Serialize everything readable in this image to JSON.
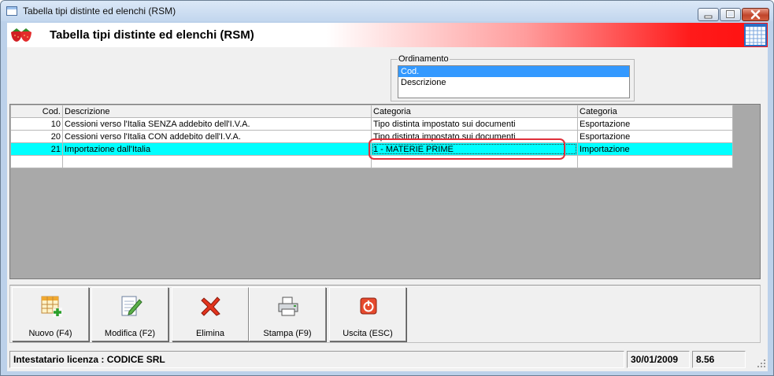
{
  "window": {
    "title": "Tabella tipi distinte ed elenchi (RSM)"
  },
  "header": {
    "title": "Tabella tipi distinte ed elenchi (RSM)"
  },
  "sort": {
    "legend": "Ordinamento",
    "options": [
      "Cod.",
      "Descrizione"
    ],
    "selected": "Cod."
  },
  "grid": {
    "columns": [
      "Cod.",
      "Descrizione",
      "Categoria",
      "Categoria"
    ],
    "rows": [
      {
        "cod": "10",
        "descrizione": "Cessioni verso l'Italia SENZA addebito dell'I.V.A.",
        "categoria1": "Tipo distinta impostato sui documenti",
        "categoria2": "Esportazione"
      },
      {
        "cod": "20",
        "descrizione": "Cessioni verso l'Italia CON addebito dell'I.V.A.",
        "categoria1": "Tipo distinta impostato sui documenti",
        "categoria2": "Esportazione"
      },
      {
        "cod": "21",
        "descrizione": "Importazione dall'Italia",
        "categoria1": "1 - MATERIE PRIME",
        "categoria2": "Importazione"
      }
    ],
    "selected_row": 2
  },
  "toolbar": {
    "new_label": "Nuovo (F4)",
    "edit_label": "Modifica (F2)",
    "delete_label": "Elimina",
    "print_label": "Stampa (F9)",
    "exit_label": "Uscita (ESC)"
  },
  "status": {
    "license": "Intestatario licenza : CODICE SRL",
    "date": "30/01/2009",
    "version": "8.56"
  },
  "colors": {
    "selected_row": "#00ffff",
    "highlight": "#e0303a",
    "list_selection": "#3399ff",
    "grid_background": "#a9a9a9"
  },
  "icons": {
    "app": "window-icon",
    "logo": "strawberries-icon",
    "calendar": "calendar-grid-icon",
    "new": "grid-add-icon",
    "edit": "edit-document-icon",
    "delete": "red-x-icon",
    "print": "printer-icon",
    "exit": "power-icon"
  }
}
